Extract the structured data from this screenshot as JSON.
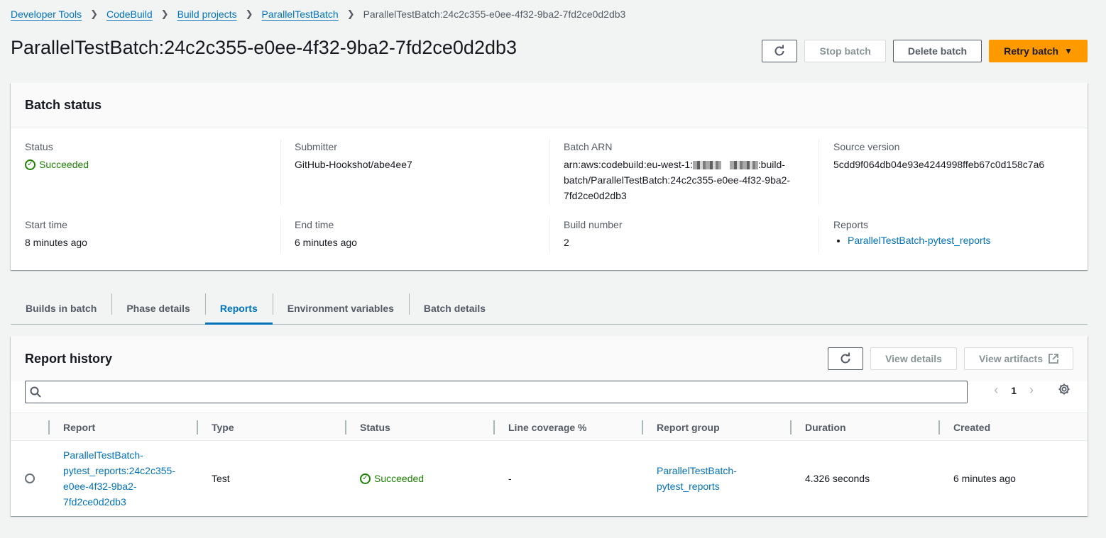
{
  "breadcrumb": {
    "items": [
      "Developer Tools",
      "CodeBuild",
      "Build projects",
      "ParallelTestBatch"
    ],
    "current": "ParallelTestBatch:24c2c355-e0ee-4f32-9ba2-7fd2ce0d2db3"
  },
  "header": {
    "title": "ParallelTestBatch:24c2c355-e0ee-4f32-9ba2-7fd2ce0d2db3",
    "stop_label": "Stop batch",
    "delete_label": "Delete batch",
    "retry_label": "Retry batch"
  },
  "batch_status": {
    "title": "Batch status",
    "status_label": "Status",
    "status_value": "Succeeded",
    "submitter_label": "Submitter",
    "submitter_value": "GitHub-Hookshot/abe4ee7",
    "arn_label": "Batch ARN",
    "arn_part1": "arn:aws:codebuild:eu-west-1:",
    "arn_part2": ":build-",
    "arn_part3": "batch/ParallelTestBatch:24c2c355-e0ee-4f32-9ba2-",
    "arn_part4": "7fd2ce0d2db3",
    "source_label": "Source version",
    "source_value": "5cdd9f064db04e93e4244998ffeb67c0d158c7a6",
    "start_label": "Start time",
    "start_value": "8 minutes ago",
    "end_label": "End time",
    "end_value": "6 minutes ago",
    "build_number_label": "Build number",
    "build_number_value": "2",
    "reports_label": "Reports",
    "reports_link": "ParallelTestBatch-pytest_reports"
  },
  "tabs": [
    {
      "label": "Builds in batch"
    },
    {
      "label": "Phase details"
    },
    {
      "label": "Reports"
    },
    {
      "label": "Environment variables"
    },
    {
      "label": "Batch details"
    }
  ],
  "report_history": {
    "title": "Report history",
    "view_details_label": "View details",
    "view_artifacts_label": "View artifacts",
    "search_placeholder": "",
    "page": "1",
    "columns": [
      "Report",
      "Type",
      "Status",
      "Line coverage %",
      "Report group",
      "Duration",
      "Created"
    ],
    "row": {
      "report_line1": "ParallelTestBatch-",
      "report_line2": "pytest_reports:24c2c355-",
      "report_line3": "e0ee-4f32-9ba2-",
      "report_line4": "7fd2ce0d2db3",
      "type": "Test",
      "status": "Succeeded",
      "line_coverage": "-",
      "group_line1": "ParallelTestBatch-",
      "group_line2": "pytest_reports",
      "duration": "4.326 seconds",
      "created": "6 minutes ago"
    }
  },
  "colors": {
    "link": "#0073bb",
    "primary": "#ff9900",
    "success": "#1d8102"
  },
  "icons": [
    "chevron-right-icon",
    "refresh-icon",
    "caret-down-icon",
    "check-circle-icon",
    "search-icon",
    "external-link-icon",
    "gear-icon",
    "angle-left-icon",
    "angle-right-icon"
  ]
}
